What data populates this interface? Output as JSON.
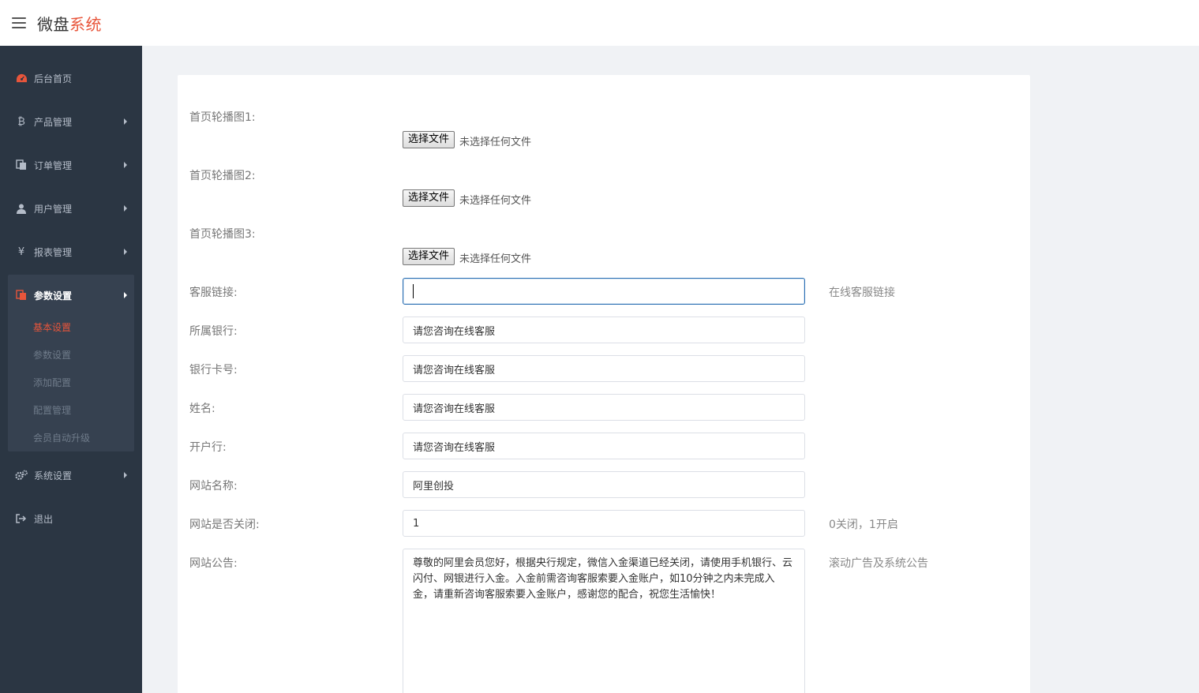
{
  "header": {
    "brand_part1": "微盘",
    "brand_part2": "系统"
  },
  "sidebar": {
    "items": [
      {
        "label": "后台首页",
        "icon": "dashboard-icon"
      },
      {
        "label": "产品管理",
        "icon": "bitcoin-icon"
      },
      {
        "label": "订单管理",
        "icon": "copy-icon"
      },
      {
        "label": "用户管理",
        "icon": "user-icon"
      },
      {
        "label": "报表管理",
        "icon": "yen-icon"
      },
      {
        "label": "参数设置",
        "icon": "files-icon"
      },
      {
        "label": "系统设置",
        "icon": "gears-icon"
      },
      {
        "label": "退出",
        "icon": "sign-out-icon"
      }
    ],
    "submenu": [
      {
        "label": "基本设置"
      },
      {
        "label": "参数设置"
      },
      {
        "label": "添加配置"
      },
      {
        "label": "配置管理"
      },
      {
        "label": "会员自动升级"
      }
    ]
  },
  "form": {
    "file_button": "选择文件",
    "file_status": "未选择任何文件",
    "banner1_label": "首页轮播图1:",
    "banner2_label": "首页轮播图2:",
    "banner3_label": "首页轮播图3:",
    "service_link_label": "客服链接:",
    "service_link_value": "",
    "service_link_hint": "在线客服链接",
    "bank_label": "所属银行:",
    "bank_value": "请您咨询在线客服",
    "card_label": "银行卡号:",
    "card_value": "请您咨询在线客服",
    "name_label": "姓名:",
    "name_value": "请您咨询在线客服",
    "branch_label": "开户行:",
    "branch_value": "请您咨询在线客服",
    "site_name_label": "网站名称:",
    "site_name_value": "阿里创投",
    "site_closed_label": "网站是否关闭:",
    "site_closed_value": "1",
    "site_closed_hint": "0关闭，1开启",
    "notice_label": "网站公告:",
    "notice_value": "尊敬的阿里会员您好，根据央行规定，微信入金渠道已经关闭，请使用手机银行、云闪付、网银进行入金。入金前需咨询客服索要入金账户，如10分钟之内未完成入金，请重新咨询客服索要入金账户，感谢您的配合，祝您生活愉快！",
    "notice_hint": "滚动广告及系统公告"
  },
  "colors": {
    "accent": "#e8553b",
    "sidebar_bg": "#2b3643",
    "submenu_bg": "#364150",
    "page_bg": "#f0f2f5"
  }
}
